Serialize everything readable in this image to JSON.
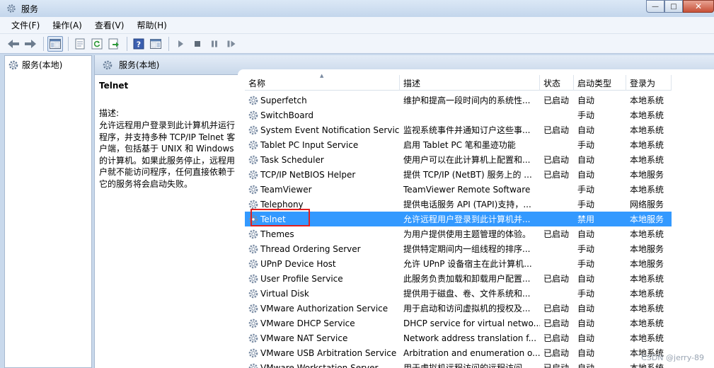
{
  "window": {
    "title": "服务",
    "minimize": "—",
    "maximize": "□",
    "close": "✕"
  },
  "menu": [
    {
      "label": "文件(F)",
      "name": "menu-file"
    },
    {
      "label": "操作(A)",
      "name": "menu-action"
    },
    {
      "label": "查看(V)",
      "name": "menu-view"
    },
    {
      "label": "帮助(H)",
      "name": "menu-help"
    }
  ],
  "tree": {
    "label": "服务(本地)"
  },
  "panel": {
    "header": "服务(本地)",
    "service_title": "Telnet",
    "desc_label": "描述:",
    "desc_text": "允许远程用户登录到此计算机并运行程序，并支持多种 TCP/IP Telnet 客户端，包括基于 UNIX 和 Windows 的计算机。如果此服务停止，远程用户就不能访问程序，任何直接依赖于它的服务将会启动失败。"
  },
  "table": {
    "columns": {
      "name": "名称",
      "desc": "描述",
      "status": "状态",
      "start": "启动类型",
      "logon": "登录为"
    },
    "rows": [
      {
        "name": "Superfetch",
        "desc": "维护和提高一段时间内的系统性...",
        "status": "已启动",
        "start": "自动",
        "logon": "本地系统"
      },
      {
        "name": "SwitchBoard",
        "desc": "",
        "status": "",
        "start": "手动",
        "logon": "本地系统"
      },
      {
        "name": "System Event Notification Service",
        "desc": "监视系统事件并通知订户这些事...",
        "status": "已启动",
        "start": "自动",
        "logon": "本地系统"
      },
      {
        "name": "Tablet PC Input Service",
        "desc": "启用 Tablet PC 笔和墨迹功能",
        "status": "",
        "start": "手动",
        "logon": "本地系统"
      },
      {
        "name": "Task Scheduler",
        "desc": "使用户可以在此计算机上配置和...",
        "status": "已启动",
        "start": "自动",
        "logon": "本地系统"
      },
      {
        "name": "TCP/IP NetBIOS Helper",
        "desc": "提供 TCP/IP (NetBT) 服务上的 ...",
        "status": "已启动",
        "start": "自动",
        "logon": "本地服务"
      },
      {
        "name": "TeamViewer",
        "desc": "TeamViewer Remote Software",
        "status": "",
        "start": "手动",
        "logon": "本地系统"
      },
      {
        "name": "Telephony",
        "desc": "提供电话服务 API (TAPI)支持，...",
        "status": "",
        "start": "手动",
        "logon": "网络服务"
      },
      {
        "name": "Telnet",
        "desc": "允许远程用户登录到此计算机并...",
        "status": "",
        "start": "禁用",
        "logon": "本地服务",
        "selected": true
      },
      {
        "name": "Themes",
        "desc": "为用户提供使用主题管理的体验。",
        "status": "已启动",
        "start": "自动",
        "logon": "本地系统"
      },
      {
        "name": "Thread Ordering Server",
        "desc": "提供特定期间内一组线程的排序...",
        "status": "",
        "start": "手动",
        "logon": "本地服务"
      },
      {
        "name": "UPnP Device Host",
        "desc": "允许 UPnP 设备宿主在此计算机...",
        "status": "",
        "start": "手动",
        "logon": "本地服务"
      },
      {
        "name": "User Profile Service",
        "desc": "此服务负责加载和卸载用户配置...",
        "status": "已启动",
        "start": "自动",
        "logon": "本地系统"
      },
      {
        "name": "Virtual Disk",
        "desc": "提供用于磁盘、卷、文件系统和...",
        "status": "",
        "start": "手动",
        "logon": "本地系统"
      },
      {
        "name": "VMware Authorization Service",
        "desc": "用于启动和访问虚拟机的授权及...",
        "status": "已启动",
        "start": "自动",
        "logon": "本地系统"
      },
      {
        "name": "VMware DHCP Service",
        "desc": "DHCP service for virtual netwo...",
        "status": "已启动",
        "start": "自动",
        "logon": "本地系统"
      },
      {
        "name": "VMware NAT Service",
        "desc": "Network address translation f...",
        "status": "已启动",
        "start": "自动",
        "logon": "本地系统"
      },
      {
        "name": "VMware USB Arbitration Service",
        "desc": "Arbitration and enumeration o...",
        "status": "已启动",
        "start": "自动",
        "logon": "本地系统"
      },
      {
        "name": "VMware Workstation Server",
        "desc": "用于虚拟机远程访问的远程访问...",
        "status": "已启动",
        "start": "自动",
        "logon": "本地系统"
      }
    ]
  },
  "watermark": "CSDN @jerry-89",
  "colors": {
    "selected_row": "#3399ff",
    "highlight_box": "#e02020"
  }
}
